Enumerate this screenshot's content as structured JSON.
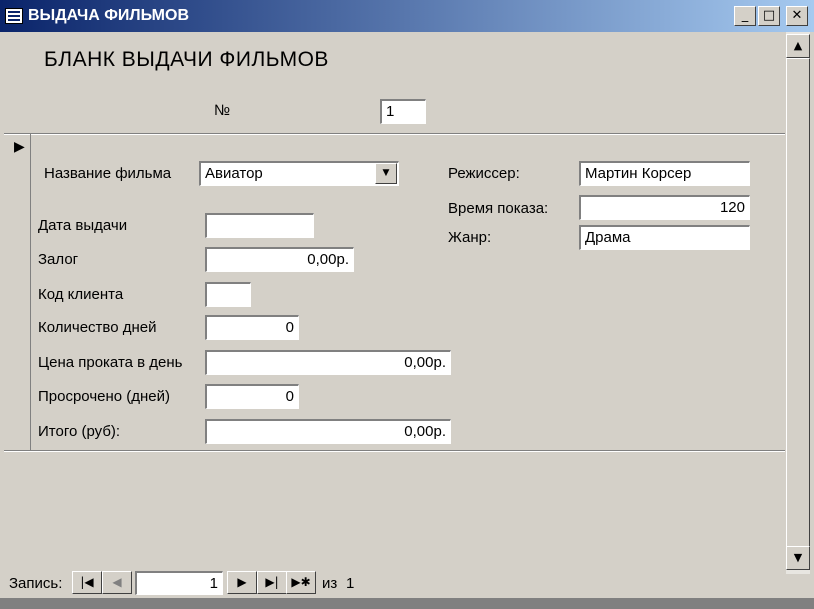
{
  "window": {
    "title": "ВЫДАЧА ФИЛЬМОВ",
    "min_glyph": "_",
    "max_glyph": "□",
    "close_glyph": "✕"
  },
  "form": {
    "heading": "БЛАНК ВЫДАЧИ ФИЛЬМОВ",
    "number_label": "№",
    "number_value": "1",
    "record_selector_glyph": "▶",
    "film_label": "Название фильма",
    "film_value": "Авиатор",
    "film_dropdown_glyph": "▼",
    "director_label": "Режиссер:",
    "director_value": "Мартин Корсер",
    "showtime_label": "Время показа:",
    "showtime_value": "120",
    "genre_label": "Жанр:",
    "genre_value": "Драма",
    "issue_date_label": "Дата выдачи",
    "issue_date_value": "",
    "deposit_label": "Залог",
    "deposit_value": "0,00р.",
    "client_code_label": "Код клиента",
    "client_code_value": "",
    "days_label": "Количество дней",
    "days_value": "0",
    "price_label": "Цена проката в день",
    "price_value": "0,00р.",
    "overdue_label": "Просрочено (дней)",
    "overdue_value": "0",
    "total_label": "Итого (руб):",
    "total_value": "0,00р."
  },
  "navigation": {
    "record_label": "Запись:",
    "current_record": "1",
    "of_label": "из",
    "total_records": "1",
    "first_glyph": "|◀",
    "prev_glyph": "◀",
    "next_glyph": "▶",
    "last_glyph": "▶|",
    "new_glyph": "▶✱"
  },
  "scrollbar": {
    "up_glyph": "▲",
    "down_glyph": "▼"
  },
  "icons": {
    "window_icon": "form-icon",
    "minimize": "minimize-icon",
    "maximize": "maximize-icon",
    "close": "close-icon",
    "record_selector": "record-pointer-icon",
    "dropdown": "chevron-down-icon"
  }
}
